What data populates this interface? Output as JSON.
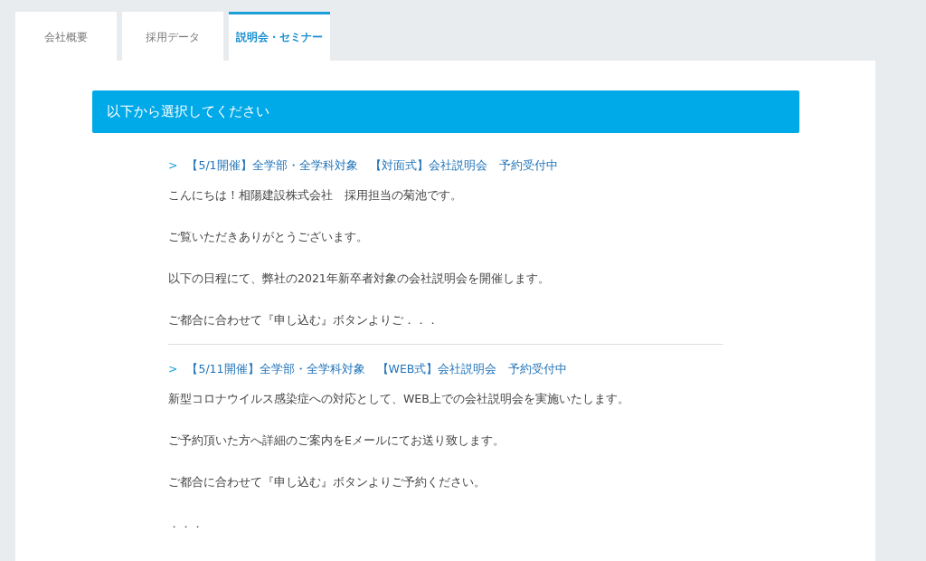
{
  "tabs": [
    {
      "label": "会社概要",
      "selected": false
    },
    {
      "label": "採用データ",
      "selected": false
    },
    {
      "label": "説明会・セミナー",
      "selected": true
    }
  ],
  "banner": "以下から選択してください",
  "events": [
    {
      "marker": ">",
      "title": "【5/1開催】全学部・全学科対象　【対面式】会社説明会　予約受付中",
      "paragraphs": [
        "こんにちは！相陽建設株式会社　採用担当の菊池です。",
        "ご覧いただきありがとうございます。",
        "以下の日程にて、弊社の2021年新卒者対象の会社説明会を開催します。",
        "ご都合に合わせて『申し込む』ボタンよりご．．．"
      ]
    },
    {
      "marker": ">",
      "title": "【5/11開催】全学部・全学科対象　【WEB式】会社説明会　予約受付中",
      "paragraphs": [
        "新型コロナウイルス感染症への対応として、WEB上での会社説明会を実施いたします。",
        "ご予約頂いた方へ詳細のご案内をEメールにてお送り致します。",
        "ご都合に合わせて『申し込む』ボタンよりご予約ください。",
        "．．．"
      ]
    }
  ]
}
